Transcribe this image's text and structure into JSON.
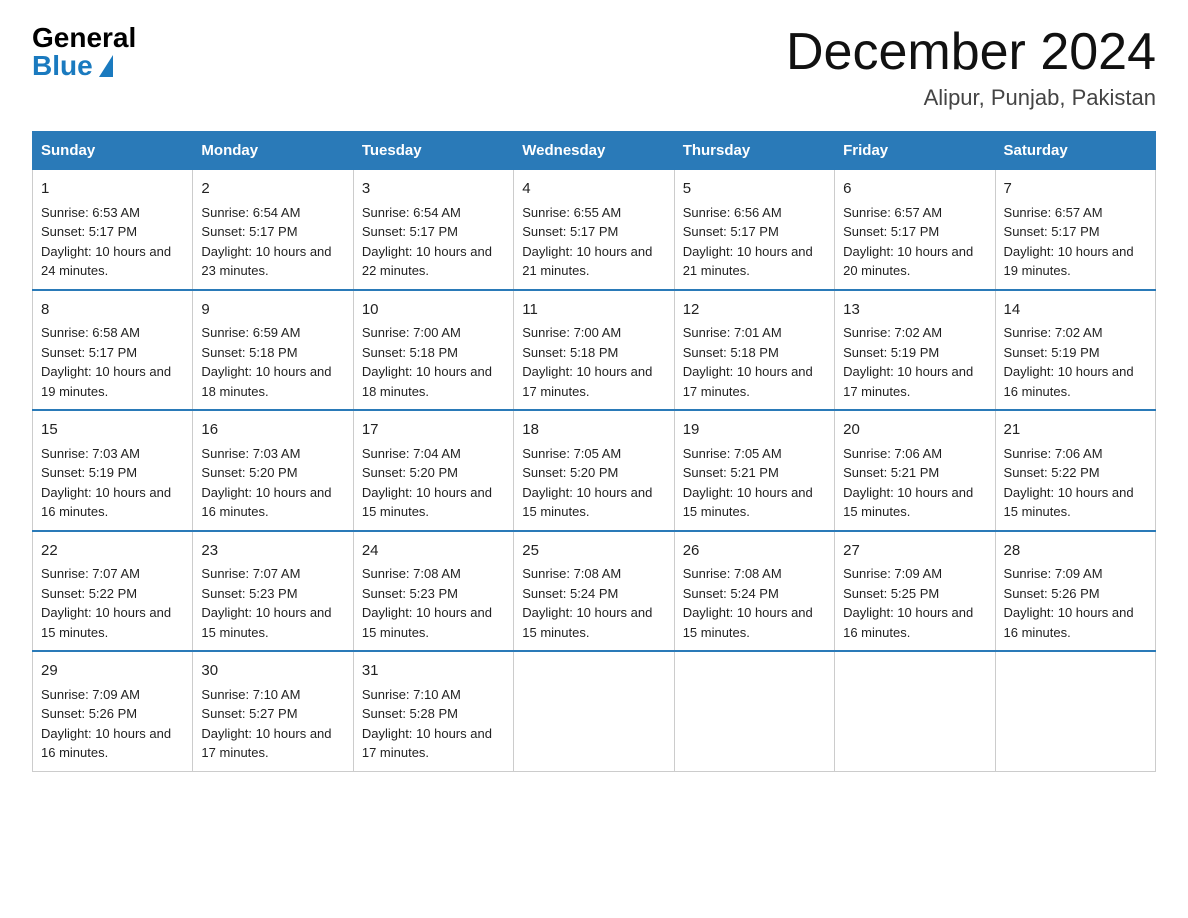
{
  "logo": {
    "general": "General",
    "blue": "Blue"
  },
  "title": "December 2024",
  "location": "Alipur, Punjab, Pakistan",
  "days_of_week": [
    "Sunday",
    "Monday",
    "Tuesday",
    "Wednesday",
    "Thursday",
    "Friday",
    "Saturday"
  ],
  "weeks": [
    [
      {
        "day": "1",
        "sunrise": "6:53 AM",
        "sunset": "5:17 PM",
        "daylight": "10 hours and 24 minutes."
      },
      {
        "day": "2",
        "sunrise": "6:54 AM",
        "sunset": "5:17 PM",
        "daylight": "10 hours and 23 minutes."
      },
      {
        "day": "3",
        "sunrise": "6:54 AM",
        "sunset": "5:17 PM",
        "daylight": "10 hours and 22 minutes."
      },
      {
        "day": "4",
        "sunrise": "6:55 AM",
        "sunset": "5:17 PM",
        "daylight": "10 hours and 21 minutes."
      },
      {
        "day": "5",
        "sunrise": "6:56 AM",
        "sunset": "5:17 PM",
        "daylight": "10 hours and 21 minutes."
      },
      {
        "day": "6",
        "sunrise": "6:57 AM",
        "sunset": "5:17 PM",
        "daylight": "10 hours and 20 minutes."
      },
      {
        "day": "7",
        "sunrise": "6:57 AM",
        "sunset": "5:17 PM",
        "daylight": "10 hours and 19 minutes."
      }
    ],
    [
      {
        "day": "8",
        "sunrise": "6:58 AM",
        "sunset": "5:17 PM",
        "daylight": "10 hours and 19 minutes."
      },
      {
        "day": "9",
        "sunrise": "6:59 AM",
        "sunset": "5:18 PM",
        "daylight": "10 hours and 18 minutes."
      },
      {
        "day": "10",
        "sunrise": "7:00 AM",
        "sunset": "5:18 PM",
        "daylight": "10 hours and 18 minutes."
      },
      {
        "day": "11",
        "sunrise": "7:00 AM",
        "sunset": "5:18 PM",
        "daylight": "10 hours and 17 minutes."
      },
      {
        "day": "12",
        "sunrise": "7:01 AM",
        "sunset": "5:18 PM",
        "daylight": "10 hours and 17 minutes."
      },
      {
        "day": "13",
        "sunrise": "7:02 AM",
        "sunset": "5:19 PM",
        "daylight": "10 hours and 17 minutes."
      },
      {
        "day": "14",
        "sunrise": "7:02 AM",
        "sunset": "5:19 PM",
        "daylight": "10 hours and 16 minutes."
      }
    ],
    [
      {
        "day": "15",
        "sunrise": "7:03 AM",
        "sunset": "5:19 PM",
        "daylight": "10 hours and 16 minutes."
      },
      {
        "day": "16",
        "sunrise": "7:03 AM",
        "sunset": "5:20 PM",
        "daylight": "10 hours and 16 minutes."
      },
      {
        "day": "17",
        "sunrise": "7:04 AM",
        "sunset": "5:20 PM",
        "daylight": "10 hours and 15 minutes."
      },
      {
        "day": "18",
        "sunrise": "7:05 AM",
        "sunset": "5:20 PM",
        "daylight": "10 hours and 15 minutes."
      },
      {
        "day": "19",
        "sunrise": "7:05 AM",
        "sunset": "5:21 PM",
        "daylight": "10 hours and 15 minutes."
      },
      {
        "day": "20",
        "sunrise": "7:06 AM",
        "sunset": "5:21 PM",
        "daylight": "10 hours and 15 minutes."
      },
      {
        "day": "21",
        "sunrise": "7:06 AM",
        "sunset": "5:22 PM",
        "daylight": "10 hours and 15 minutes."
      }
    ],
    [
      {
        "day": "22",
        "sunrise": "7:07 AM",
        "sunset": "5:22 PM",
        "daylight": "10 hours and 15 minutes."
      },
      {
        "day": "23",
        "sunrise": "7:07 AM",
        "sunset": "5:23 PM",
        "daylight": "10 hours and 15 minutes."
      },
      {
        "day": "24",
        "sunrise": "7:08 AM",
        "sunset": "5:23 PM",
        "daylight": "10 hours and 15 minutes."
      },
      {
        "day": "25",
        "sunrise": "7:08 AM",
        "sunset": "5:24 PM",
        "daylight": "10 hours and 15 minutes."
      },
      {
        "day": "26",
        "sunrise": "7:08 AM",
        "sunset": "5:24 PM",
        "daylight": "10 hours and 15 minutes."
      },
      {
        "day": "27",
        "sunrise": "7:09 AM",
        "sunset": "5:25 PM",
        "daylight": "10 hours and 16 minutes."
      },
      {
        "day": "28",
        "sunrise": "7:09 AM",
        "sunset": "5:26 PM",
        "daylight": "10 hours and 16 minutes."
      }
    ],
    [
      {
        "day": "29",
        "sunrise": "7:09 AM",
        "sunset": "5:26 PM",
        "daylight": "10 hours and 16 minutes."
      },
      {
        "day": "30",
        "sunrise": "7:10 AM",
        "sunset": "5:27 PM",
        "daylight": "10 hours and 17 minutes."
      },
      {
        "day": "31",
        "sunrise": "7:10 AM",
        "sunset": "5:28 PM",
        "daylight": "10 hours and 17 minutes."
      },
      null,
      null,
      null,
      null
    ]
  ]
}
